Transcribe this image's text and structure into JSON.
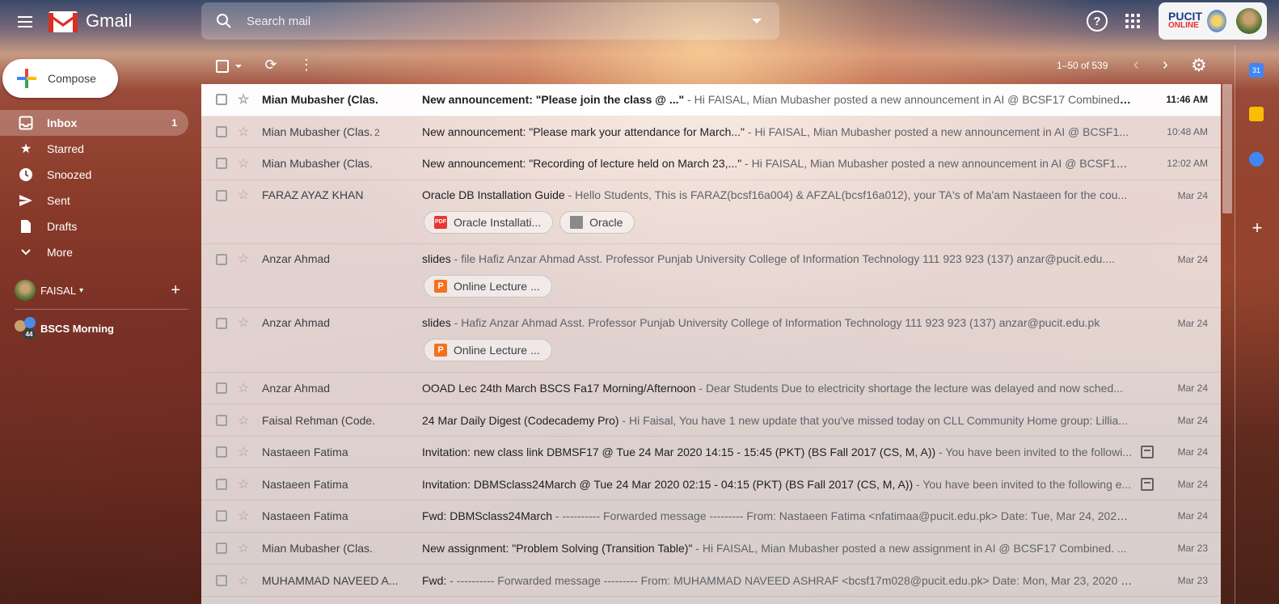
{
  "app": {
    "name": "Gmail"
  },
  "search": {
    "placeholder": "Search mail"
  },
  "account": {
    "org_line1": "PUCIT",
    "org_line2": "ONLINE"
  },
  "compose": {
    "label": "Compose"
  },
  "nav": [
    {
      "label": "Inbox",
      "count": "1",
      "icon": "inbox-icon",
      "active": true
    },
    {
      "label": "Starred",
      "count": "",
      "icon": "star-icon"
    },
    {
      "label": "Snoozed",
      "count": "",
      "icon": "clock-icon"
    },
    {
      "label": "Sent",
      "count": "",
      "icon": "send-icon"
    },
    {
      "label": "Drafts",
      "count": "",
      "icon": "draft-icon"
    },
    {
      "label": "More",
      "count": "",
      "icon": "chevron-down-icon"
    }
  ],
  "hangouts": {
    "user": "FAISAL",
    "group": "BSCS Morning",
    "group_badge": "44"
  },
  "toolbar": {
    "pagination": "1–50 of 539"
  },
  "calendar_day": "31",
  "emails": [
    {
      "sender": "Mian Mubasher (Clas.",
      "count": "",
      "subject": "New announcement: \"Please join the class @ ...\"",
      "snippet": " - Hi FAISAL, Mian Mubasher posted a new announcement in AI @ BCSF17 Combined. Pl...",
      "time": "11:46 AM",
      "unread": true
    },
    {
      "sender": "Mian Mubasher (Clas.",
      "count": "2",
      "subject": "New announcement: \"Please mark your attendance for March...\"",
      "snippet": " - Hi FAISAL, Mian Mubasher posted a new announcement in AI @ BCSF1...",
      "time": "10:48 AM"
    },
    {
      "sender": "Mian Mubasher (Clas.",
      "count": "",
      "subject": "New announcement: \"Recording of lecture held on March 23,...\"",
      "snippet": " - Hi FAISAL, Mian Mubasher posted a new announcement in AI @ BCSF17 ...",
      "time": "12:02 AM"
    },
    {
      "sender": "FARAZ AYAZ KHAN",
      "count": "",
      "subject": "Oracle DB Installation Guide",
      "snippet": " - Hello Students, This is FARAZ(bcsf16a004) & AFZAL(bcsf16a012), your TA's of Ma'am Nastaeen for the cou...",
      "time": "Mar 24",
      "attachments": [
        {
          "type": "pdf",
          "name": "Oracle Installati..."
        },
        {
          "type": "folder",
          "name": "Oracle"
        }
      ]
    },
    {
      "sender": "Anzar Ahmad",
      "count": "",
      "subject": "slides",
      "snippet": " - file Hafiz Anzar Ahmad Asst. Professor Punjab University College of Information Technology 111 923 923 (137) anzar@pucit.edu....",
      "time": "Mar 24",
      "attachments": [
        {
          "type": "ppt",
          "name": "Online Lecture ..."
        }
      ]
    },
    {
      "sender": "Anzar Ahmad",
      "count": "",
      "subject": "slides",
      "snippet": " - Hafiz Anzar Ahmad Asst. Professor Punjab University College of Information Technology 111 923 923 (137) anzar@pucit.edu.pk",
      "time": "Mar 24",
      "attachments": [
        {
          "type": "ppt",
          "name": "Online Lecture ..."
        }
      ]
    },
    {
      "sender": "Anzar Ahmad",
      "count": "",
      "subject": "OOAD Lec 24th March BSCS Fa17 Morning/Afternoon",
      "snippet": " - Dear Students Due to electricity shortage the lecture was delayed and now sched...",
      "time": "Mar 24"
    },
    {
      "sender": "Faisal Rehman (Code.",
      "count": "",
      "subject": "24 Mar Daily Digest (Codecademy Pro)",
      "snippet": " - Hi Faisal, You have 1 new update that you've missed today on CLL Community Home group: Lillia...",
      "time": "Mar 24"
    },
    {
      "sender": "Nastaeen Fatima",
      "count": "",
      "subject": "Invitation: new class link DBMSF17 @ Tue 24 Mar 2020 14:15 - 15:45 (PKT) (BS Fall 2017 (CS, M, A))",
      "snippet": " - You have been invited to the followi...",
      "time": "Mar 24",
      "calendar": true
    },
    {
      "sender": "Nastaeen Fatima",
      "count": "",
      "subject": "Invitation: DBMSclass24March @ Tue 24 Mar 2020 02:15 - 04:15 (PKT) (BS Fall 2017 (CS, M, A))",
      "snippet": " - You have been invited to the following e...",
      "time": "Mar 24",
      "calendar": true
    },
    {
      "sender": "Nastaeen Fatima",
      "count": "",
      "subject": "Fwd: DBMSclass24March",
      "snippet": " - ---------- Forwarded message --------- From: Nastaeen Fatima <nfatimaa@pucit.edu.pk> Date: Tue, Mar 24, 2020 a...",
      "time": "Mar 24"
    },
    {
      "sender": "Mian Mubasher (Clas.",
      "count": "",
      "subject": "New assignment: \"Problem Solving (Transition Table)\"",
      "snippet": " - Hi FAISAL, Mian Mubasher posted a new assignment in AI @ BCSF17 Combined. ...",
      "time": "Mar 23"
    },
    {
      "sender": "MUHAMMAD NAVEED A...",
      "count": "",
      "subject": "Fwd:",
      "snippet": " - ---------- Forwarded message --------- From: MUHAMMAD NAVEED ASHRAF <bcsf17m028@pucit.edu.pk> Date: Mon, Mar 23, 2020 at ...",
      "time": "Mar 23"
    }
  ]
}
